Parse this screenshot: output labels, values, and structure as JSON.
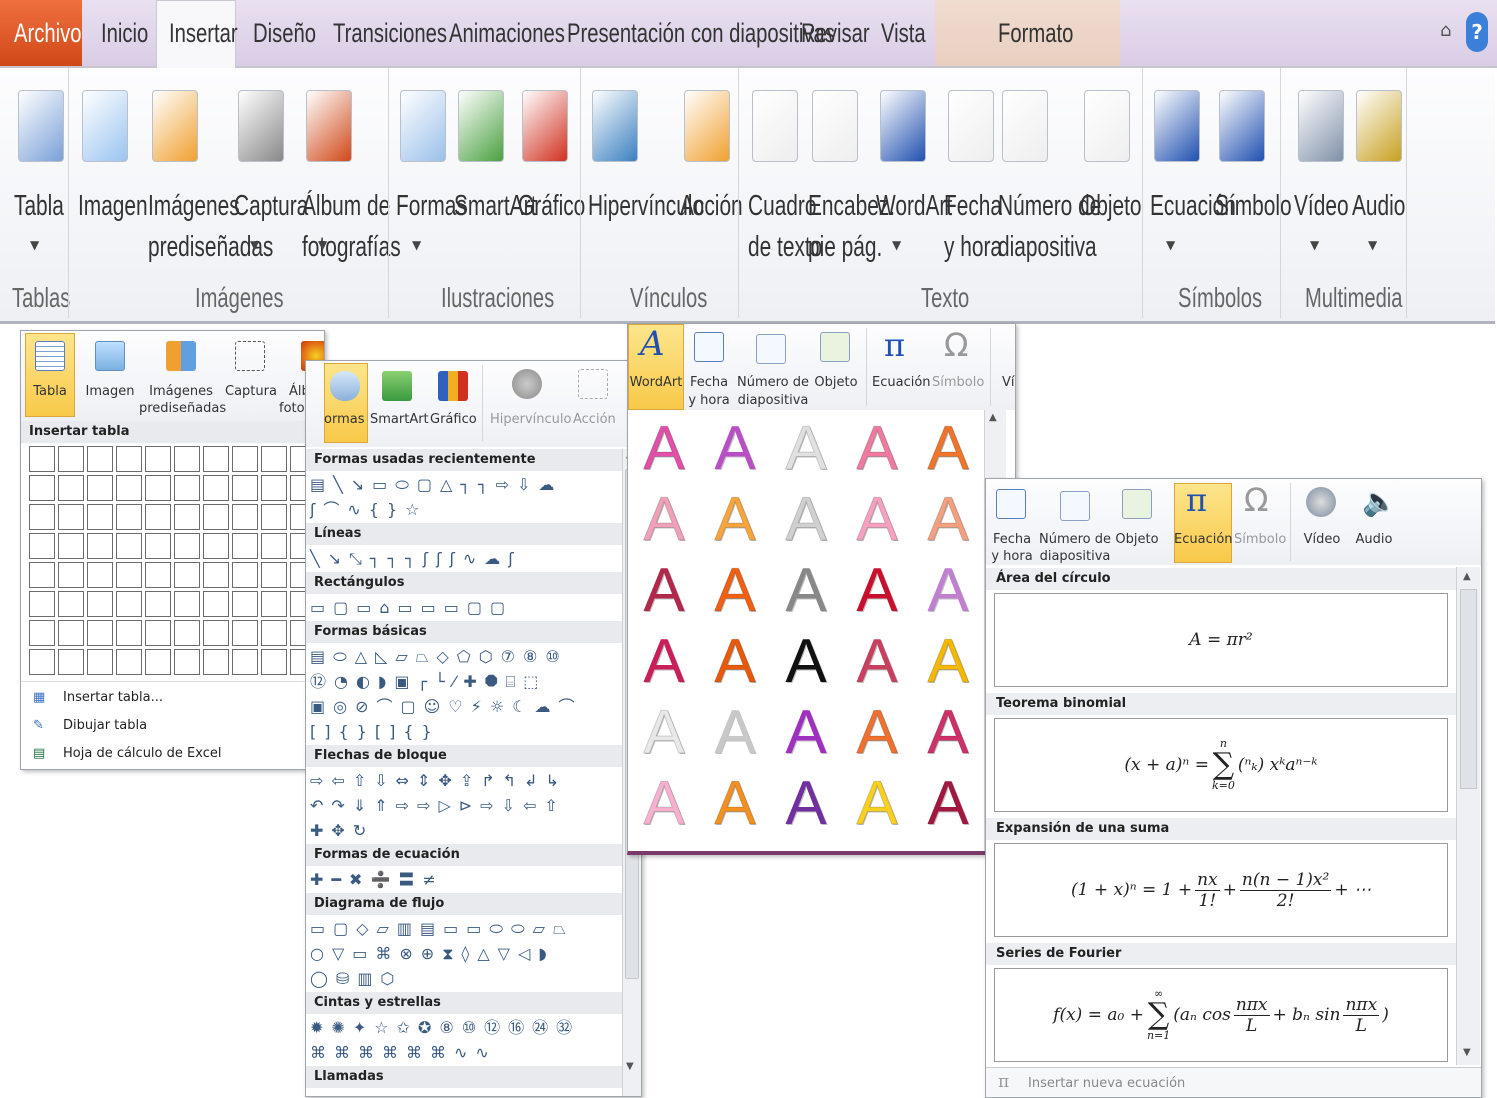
{
  "tabs": [
    "Archivo",
    "Inicio",
    "Insertar",
    "Diseño",
    "Transiciones",
    "Animaciones",
    "Presentación con diapositivas",
    "Revisar",
    "Vista",
    "Formato"
  ],
  "help": "?",
  "ribbon": {
    "buttons": [
      [
        "Tabla",
        ""
      ],
      [
        "Imagen",
        ""
      ],
      [
        "Imágenes",
        "prediseñadas"
      ],
      [
        "Captura",
        ""
      ],
      [
        "Álbum de",
        "fotografías"
      ],
      [
        "Formas",
        ""
      ],
      [
        "SmartArt",
        ""
      ],
      [
        "Gráfico",
        ""
      ],
      [
        "Hipervínculo",
        ""
      ],
      [
        "Acción",
        ""
      ],
      [
        "Cuadro",
        "de texto"
      ],
      [
        "Encabez.",
        "pie pág."
      ],
      [
        "WordArt",
        ""
      ],
      [
        "Fecha",
        "y hora"
      ],
      [
        "Número de",
        "diapositiva"
      ],
      [
        "Objeto",
        ""
      ],
      [
        "Ecuación",
        ""
      ],
      [
        "Símbolo",
        ""
      ],
      [
        "Vídeo",
        ""
      ],
      [
        "Audio",
        ""
      ]
    ],
    "groups": [
      "Tablas",
      "Imágenes",
      "Ilustraciones",
      "Vínculos",
      "Texto",
      "Símbolos",
      "Multimedia"
    ]
  },
  "table_panel": {
    "buttons": [
      "Tabla",
      "Imagen",
      "Imágenes prediseñadas",
      "Captura",
      "Álbum de fotografías"
    ],
    "buttons_short": [
      "Tabla",
      "Imagen",
      "Imágenes",
      "prediseñadas",
      "Captura",
      "Álbum",
      "fotogra"
    ],
    "header": "Insertar tabla",
    "grid": {
      "rows": 8,
      "cols": 10
    },
    "menu": [
      "Insertar tabla...",
      "Dibujar tabla",
      "Hoja de cálculo de Excel"
    ]
  },
  "shapes_panel": {
    "buttons": [
      "ormas",
      "SmartArt",
      "Gráfico",
      "Hipervínculo",
      "Acción"
    ],
    "sections": [
      {
        "title": "Formas usadas recientemente",
        "rows": [
          "▤╲↘▭⬭▢△┐┐⇨⇩☁",
          "ʃ⌒∿{}☆"
        ]
      },
      {
        "title": "Líneas",
        "rows": [
          "╲↘⤡┐┐┐ʃʃʃ∿☁ʃ"
        ]
      },
      {
        "title": "Rectángulos",
        "rows": [
          "▭▢▭⌂▭▭▭▢▢"
        ]
      },
      {
        "title": "Formas básicas",
        "rows": [
          "▤⬭△◺▱⏢◇⬠⬡⑦⑧⑩",
          "⑫◔◐◗▣┌└⁄✚⯃⌸⬚",
          "▣◎⊘⌒▢☺♡⚡☼☾☁⌒",
          "[]{}[]{}"
        ]
      },
      {
        "title": "Flechas de bloque",
        "rows": [
          "⇨⇦⇧⇩⇔⇕✥⇪↱↰↲↳",
          "↶↷⇓⇑⇨⇨▷⊳⇨⇩⇦⇧",
          "✚✥↻"
        ]
      },
      {
        "title": "Formas de ecuación",
        "rows": [
          "✚━✖➗〓≠"
        ]
      },
      {
        "title": "Diagrama de flujo",
        "rows": [
          "▭▢◇▱▥▤▭▭⬭⬭▱⏢",
          "○▽▭⌘⊗⊕⧗◊△▽◁◗",
          "◯⛁▥⬡"
        ]
      },
      {
        "title": "Cintas y estrellas",
        "rows": [
          "✹✺✦☆✩✪⑧⑩⑫⑯㉔㉜",
          "⌘⌘⌘⌘⌘⌘∿∿"
        ]
      },
      {
        "title": "Llamadas",
        "rows": []
      }
    ]
  },
  "wordart_panel": {
    "buttons": [
      "WordArt",
      "Fecha",
      "y hora",
      "Número de",
      "diapositiva",
      "Objeto",
      "Ecuación",
      "Símbolo",
      "Ví"
    ],
    "letter": "A",
    "styles": [
      [
        "#e14fa8",
        "#b94fc4",
        "#e0e0e0",
        "#f07aa0",
        "#f0752a"
      ],
      [
        "#f0a0b8",
        "#f7a43c",
        "#d0d0d0",
        "#f7a0c0",
        "#f4a080"
      ],
      [
        "#b0284c",
        "#f06010",
        "#888888",
        "#c8102e",
        "#c080d0"
      ],
      [
        "#c81e5a",
        "#e85a0a",
        "#111111",
        "#c84060",
        "#f4b800"
      ],
      [
        "#e8e8e8",
        "#c8c8c8",
        "#a030c0",
        "#f07030",
        "#d0306a"
      ],
      [
        "#f8b0d0",
        "#f49020",
        "#7030a0",
        "#f8d020",
        "#a01840"
      ]
    ]
  },
  "equation_panel": {
    "buttons": [
      "Fecha",
      "y hora",
      "Número de",
      "diapositiva",
      "Objeto",
      "Ecuación",
      "Símbolo",
      "Vídeo",
      "Audio"
    ],
    "items": [
      {
        "title": "Área del círculo",
        "eq": "A = πr²"
      },
      {
        "title": "Teorema binomial",
        "lhs": "(x + a)ⁿ = ",
        "sum_top": "n",
        "sum_bot": "k=0",
        "rhs": "(ⁿₖ) xᵏaⁿ⁻ᵏ"
      },
      {
        "title": "Expansión de una suma",
        "lhs": "(1 + x)ⁿ = 1 + ",
        "f1n": "nx",
        "f1d": "1!",
        "mid": " + ",
        "f2n": "n(n − 1)x²",
        "f2d": "2!",
        "tail": " + ⋯"
      },
      {
        "title": "Series de Fourier",
        "lhs": "f(x) = a₀ + ",
        "sum_top": "∞",
        "sum_bot": "n=1",
        "a": "(aₙ cos",
        "f1n": "nπx",
        "f1d": "L",
        "b": " + bₙ sin",
        "f2n": "nπx",
        "f2d": "L",
        "close": ")"
      }
    ],
    "footer": "Insertar nueva ecuación",
    "footer_icon": "π"
  }
}
